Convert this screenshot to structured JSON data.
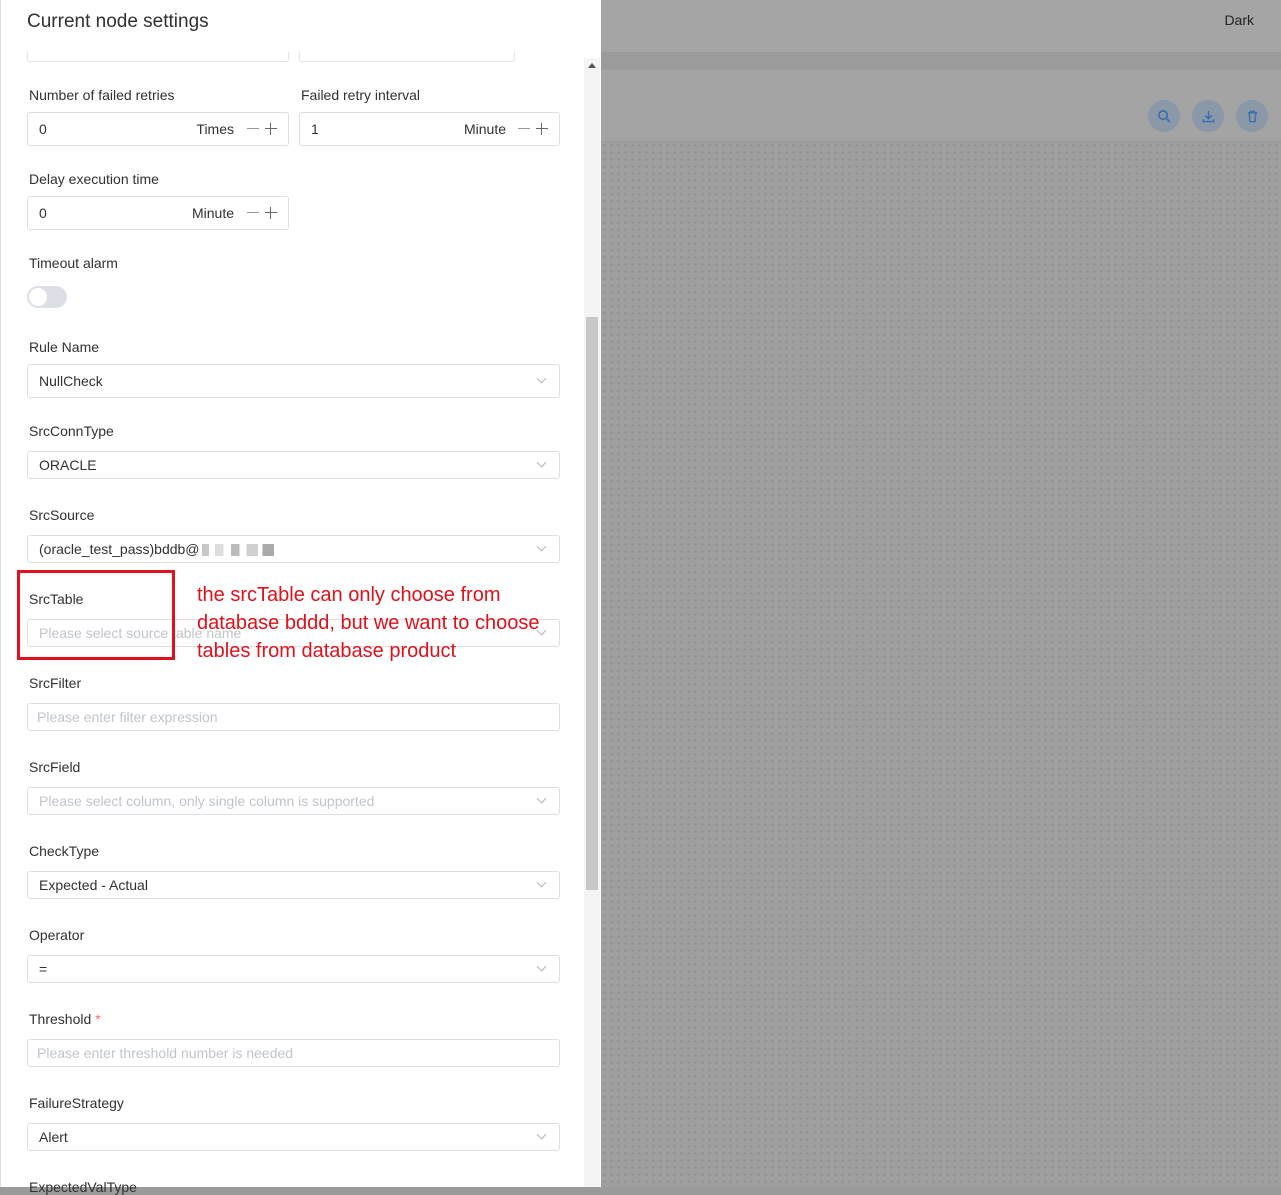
{
  "app": {
    "theme_label": "Dark"
  },
  "toolbar": {
    "icons": [
      "search-icon",
      "download-icon",
      "trash-icon"
    ],
    "accent": "#8a98a8"
  },
  "drawer": {
    "title": "Current node settings"
  },
  "form": {
    "failed_retries": {
      "label": "Number of failed retries",
      "value": "0",
      "unit": "Times"
    },
    "retry_interval": {
      "label": "Failed retry interval",
      "value": "1",
      "unit": "Minute"
    },
    "delay_time": {
      "label": "Delay execution time",
      "value": "0",
      "unit": "Minute"
    },
    "timeout_alarm": {
      "label": "Timeout alarm",
      "enabled": false
    },
    "rule_name": {
      "label": "Rule Name",
      "value": "NullCheck"
    },
    "src_conn_type": {
      "label": "SrcConnType",
      "value": "ORACLE"
    },
    "src_source": {
      "label": "SrcSource",
      "value": "(oracle_test_pass)bddb@"
    },
    "src_table": {
      "label": "SrcTable",
      "placeholder": "Please select source table name"
    },
    "src_filter": {
      "label": "SrcFilter",
      "placeholder": "Please enter filter expression"
    },
    "src_field": {
      "label": "SrcField",
      "placeholder": "Please select column, only single column is supported"
    },
    "check_type": {
      "label": "CheckType",
      "value": "Expected - Actual"
    },
    "operator": {
      "label": "Operator",
      "value": "="
    },
    "threshold": {
      "label": "Threshold",
      "required_mark": "*",
      "placeholder": "Please enter threshold number is needed"
    },
    "failure_strategy": {
      "label": "FailureStrategy",
      "value": "Alert"
    },
    "expected_val_type": {
      "label": "ExpectedValType"
    }
  },
  "annotation": {
    "text": "the srcTable can only choose from database bddd, but we want to choose tables from database product",
    "color": "#e0111a"
  }
}
